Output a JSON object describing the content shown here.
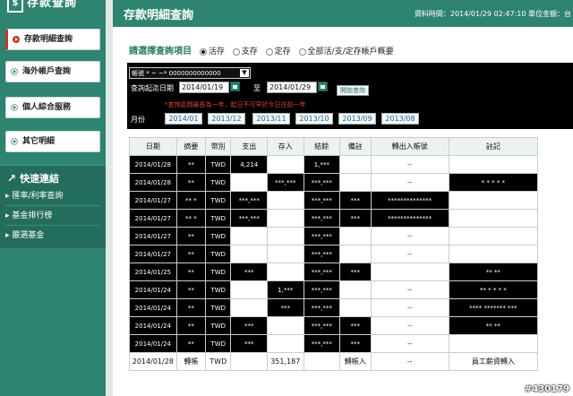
{
  "app": {
    "logo_text": "存款查詢",
    "logo_mark": "$"
  },
  "sidebar": {
    "items": [
      {
        "label": "存款明細查詢"
      },
      {
        "label": "海外帳戶查詢"
      },
      {
        "label": "個人綜合服務"
      },
      {
        "label": "其它明細"
      }
    ],
    "quick_title": "快速連結",
    "quick_links": [
      {
        "label": "匯率/利率查詢"
      },
      {
        "label": "基金排行榜"
      },
      {
        "label": "嚴選基金"
      }
    ]
  },
  "header": {
    "title": "存款明細查詢",
    "info": "資料時間：2014/01/29 02:47:10 單位金額：台"
  },
  "query": {
    "prompt": "請選擇查詢項目",
    "options": [
      {
        "label": "活存",
        "selected": true
      },
      {
        "label": "支存",
        "selected": false
      },
      {
        "label": "定存",
        "selected": false
      },
      {
        "label": "全部活/支/定存帳戶概要",
        "selected": false
      }
    ],
    "account_label": "帳號",
    "account_value": "* ~ ~* 0000000000000",
    "date_label": "查詢起迄日期",
    "start_date": "2014/01/19",
    "to_label": "至",
    "end_date": "2014/01/29",
    "submit_label": "開始查詢",
    "note": "*查詢區間最長為一年，起日不可早於今日往前一年",
    "month_label": "月份",
    "months": [
      "2014/01",
      "2013/12",
      "2013/11",
      "2013/10",
      "2013/09",
      "2013/08"
    ]
  },
  "table": {
    "headers": [
      "日期",
      "摘要",
      "幣別",
      "支出",
      "存入",
      "結餘",
      "備註",
      "轉出入帳號",
      "註記"
    ],
    "rows": [
      [
        "2014/01/28",
        "**",
        "TWD",
        "4,214",
        "",
        "1,***",
        "",
        "--",
        ""
      ],
      [
        "2014/01/28",
        "**",
        "TWD",
        "",
        "***,***",
        "***,***",
        "",
        "--",
        "* * * * *"
      ],
      [
        "2014/01/27",
        "** *",
        "TWD",
        "***,***",
        "",
        "***,***",
        "***",
        "**************",
        ""
      ],
      [
        "2014/01/27",
        "** *",
        "TWD",
        "***,***",
        "",
        "***,***",
        "***",
        "**************",
        ""
      ],
      [
        "2014/01/27",
        "**",
        "TWD",
        "",
        "",
        "***,***",
        "",
        "--",
        ""
      ],
      [
        "2014/01/27",
        "**",
        "TWD",
        "",
        "",
        "***,***",
        "",
        "--",
        ""
      ],
      [
        "2014/01/25",
        "**",
        "TWD",
        "***",
        "",
        "***,***",
        "***",
        "",
        "** **"
      ],
      [
        "2014/01/24",
        "**",
        "TWD",
        "",
        "1,***",
        "***,***",
        "",
        "--",
        "** * * * *"
      ],
      [
        "2014/01/24",
        "**",
        "TWD",
        "",
        "***",
        "***,***",
        "",
        "--",
        "**** ******* ***"
      ],
      [
        "2014/01/24",
        "**",
        "TWD",
        "***",
        "",
        "***,***",
        "***",
        "--",
        "** **"
      ],
      [
        "2014/01/24",
        "**",
        "TWD",
        "***",
        "",
        "***,***",
        "***",
        "--",
        ""
      ],
      [
        "2014/01/28",
        "轉帳",
        "TWD",
        "",
        "351,187",
        "",
        "轉帳入",
        "--",
        "員工薪資轉入"
      ]
    ]
  },
  "watermark": "#430179"
}
